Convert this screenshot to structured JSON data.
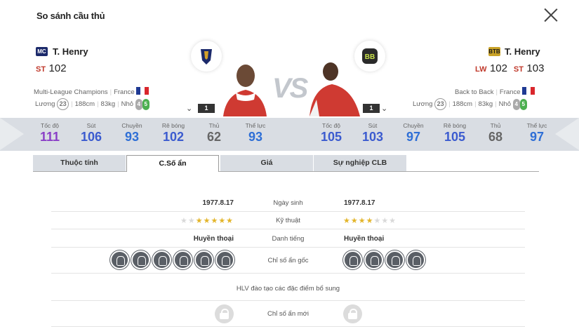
{
  "window": {
    "title": "So sánh cầu thủ"
  },
  "left_player": {
    "season_badge": "MC",
    "season_color": "#1c2a6b",
    "name": "T. Henry",
    "positions": [
      {
        "pos": "ST",
        "ovr": "102",
        "color": "#c0392b"
      }
    ],
    "season_name": "Multi-League Champions",
    "nation": "France",
    "age": "23",
    "height": "188cm",
    "weight": "83kg",
    "body": "Nhỏ",
    "weak_foot": "4",
    "strong_foot": "5",
    "level": "1"
  },
  "right_player": {
    "season_badge": "BTB",
    "season_color": "#c9a227",
    "name": "T. Henry",
    "positions": [
      {
        "pos": "LW",
        "ovr": "102",
        "color": "#c0392b"
      },
      {
        "pos": "ST",
        "ovr": "103",
        "color": "#c0392b"
      }
    ],
    "season_name": "Back to Back",
    "nation": "France",
    "age": "23",
    "height": "188cm",
    "weight": "83kg",
    "body": "Nhỏ",
    "weak_foot": "4",
    "strong_foot": "5",
    "level": "1"
  },
  "vs_label": "VS",
  "stats_left": [
    {
      "label": "Tốc độ",
      "value": "111",
      "color": "#8a3fc7"
    },
    {
      "label": "Sút",
      "value": "106",
      "color": "#3b5bcf"
    },
    {
      "label": "Chuyền",
      "value": "93",
      "color": "#2f6fd6"
    },
    {
      "label": "Rê bóng",
      "value": "102",
      "color": "#3b5bcf"
    },
    {
      "label": "Thủ",
      "value": "62",
      "color": "#666666"
    },
    {
      "label": "Thể lực",
      "value": "93",
      "color": "#2f6fd6"
    }
  ],
  "stats_right": [
    {
      "label": "Tốc độ",
      "value": "105",
      "color": "#3b5bcf"
    },
    {
      "label": "Sút",
      "value": "103",
      "color": "#3b5bcf"
    },
    {
      "label": "Chuyền",
      "value": "97",
      "color": "#2f6fd6"
    },
    {
      "label": "Rê bóng",
      "value": "105",
      "color": "#3b5bcf"
    },
    {
      "label": "Thủ",
      "value": "68",
      "color": "#666666"
    },
    {
      "label": "Thể lực",
      "value": "97",
      "color": "#2f6fd6"
    }
  ],
  "tabs": [
    {
      "label": "Thuộc tính",
      "active": false
    },
    {
      "label": "C.Số ẩn",
      "active": true
    },
    {
      "label": "Giá",
      "active": false
    },
    {
      "label": "Sự nghiệp CLB",
      "active": false
    }
  ],
  "rows": {
    "birth": {
      "label": "Ngày sinh",
      "left": "1977.8.17",
      "right": "1977.8.17"
    },
    "skill": {
      "label": "Kỹ thuật",
      "left_stars": 5,
      "right_stars": 4,
      "max": 7
    },
    "reputation": {
      "label": "Danh tiếng",
      "left": "Huyền thoại",
      "right": "Huyền thoại"
    },
    "traits": {
      "label": "Chỉ số ẩn gốc",
      "left_count": 6,
      "right_count": 4
    },
    "hlv": {
      "label": "HLV đào tạo các đặc điểm bổ sung"
    },
    "new_traits": {
      "label": "Chỉ số ẩn mới"
    }
  }
}
